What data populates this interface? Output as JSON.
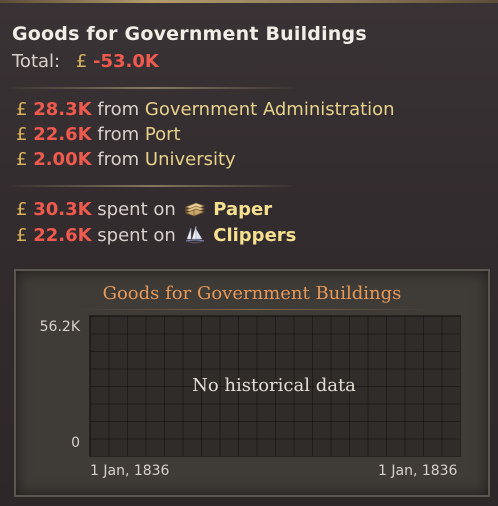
{
  "tooltip": {
    "title": "Goods for Government Buildings",
    "total_label": "Total:",
    "currency_symbol": "£",
    "total_value": "-53.0K"
  },
  "sources": [
    {
      "value": "28.3K",
      "word": "from",
      "name": "Government Administration"
    },
    {
      "value": "22.6K",
      "word": "from",
      "name": "Port"
    },
    {
      "value": "2.00K",
      "word": "from",
      "name": "University"
    }
  ],
  "spending": [
    {
      "value": "30.3K",
      "word": "spent on",
      "good": "Paper",
      "icon": "paper-icon"
    },
    {
      "value": "22.6K",
      "word": "spent on",
      "good": "Clippers",
      "icon": "clipper-ship-icon"
    }
  ],
  "chart": {
    "title": "Goods for Government Buildings",
    "y_max_label": "56.2K",
    "y_min_label": "0",
    "x_start_label": "1 Jan, 1836",
    "x_end_label": "1 Jan, 1836",
    "empty_message": "No historical data"
  },
  "colors": {
    "negative": "#ef5a4e",
    "currency": "#d9b35a",
    "source_name": "#e6d28a",
    "chart_title": "#e7995a"
  }
}
